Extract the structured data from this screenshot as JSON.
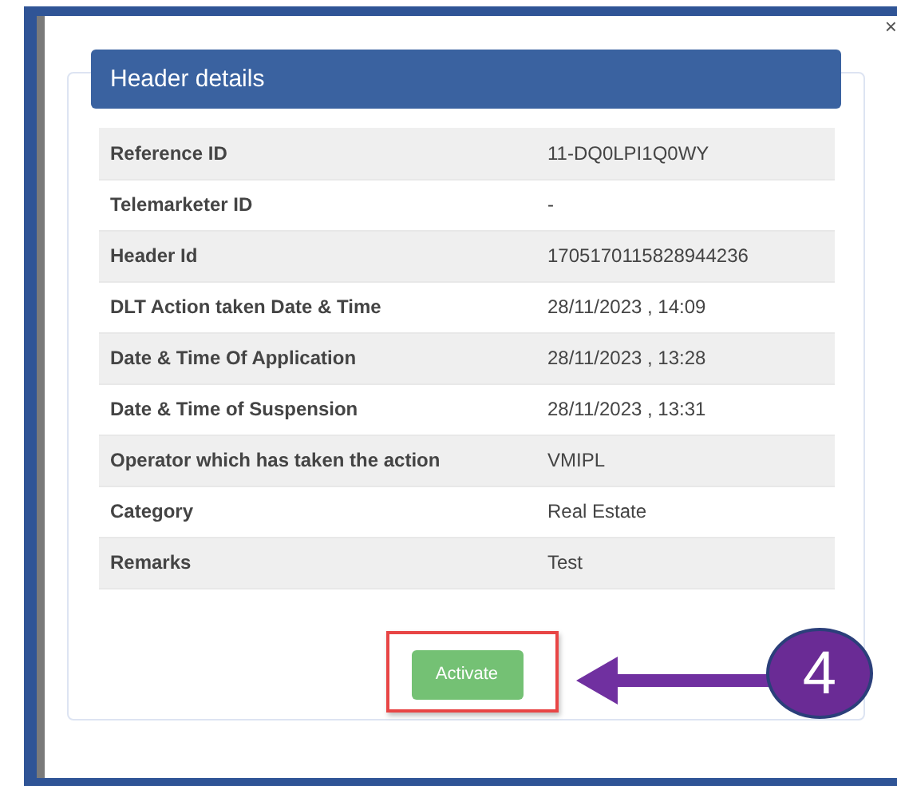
{
  "modal": {
    "close": "×",
    "title": "Header details",
    "rows": [
      {
        "label": "Reference ID",
        "value": "11-DQ0LPI1Q0WY"
      },
      {
        "label": "Telemarketer ID",
        "value": "-"
      },
      {
        "label": "Header Id",
        "value": "1705170115828944236"
      },
      {
        "label": "DLT Action taken Date & Time",
        "value": "28/11/2023 , 14:09"
      },
      {
        "label": "Date & Time Of Application",
        "value": "28/11/2023 , 13:28"
      },
      {
        "label": "Date & Time of Suspension",
        "value": "28/11/2023 , 13:31"
      },
      {
        "label": "Operator which has taken the action",
        "value": "VMIPL"
      },
      {
        "label": "Category",
        "value": "Real Estate"
      },
      {
        "label": "Remarks",
        "value": "Test"
      }
    ],
    "button": "Activate"
  },
  "annotation": {
    "step": "4"
  }
}
